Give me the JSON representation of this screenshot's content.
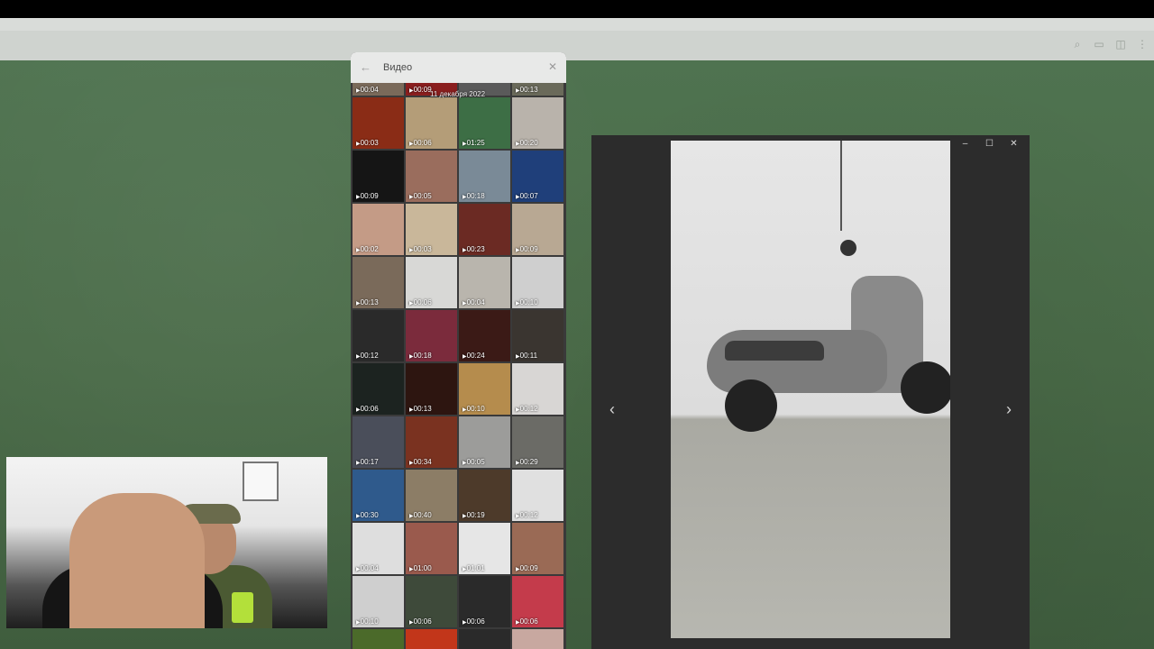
{
  "panel": {
    "title": "Видео",
    "date_label": "11 декабря 2022",
    "first_row_durations": [
      "00:04",
      "00:09",
      "",
      "00:13"
    ],
    "thumbnails": [
      {
        "duration": "00:03",
        "color": "#8a2c16"
      },
      {
        "duration": "00:06",
        "color": "#b49d78"
      },
      {
        "duration": "01:25",
        "color": "#3d6e45"
      },
      {
        "duration": "00:20",
        "color": "#b9b3ab"
      },
      {
        "duration": "00:09",
        "color": "#151515"
      },
      {
        "duration": "00:05",
        "color": "#9a6d5d"
      },
      {
        "duration": "00:18",
        "color": "#7a8a97"
      },
      {
        "duration": "00:07",
        "color": "#1f3f7a"
      },
      {
        "duration": "00:02",
        "color": "#c49b86"
      },
      {
        "duration": "00:03",
        "color": "#c9b79a"
      },
      {
        "duration": "00:23",
        "color": "#6b2a23"
      },
      {
        "duration": "00:09",
        "color": "#b8a893"
      },
      {
        "duration": "00:13",
        "color": "#7a6a5a"
      },
      {
        "duration": "00:06",
        "color": "#d8d8d6"
      },
      {
        "duration": "00:04",
        "color": "#b9b5ad"
      },
      {
        "duration": "00:10",
        "color": "#cfcfcf"
      },
      {
        "duration": "00:12",
        "color": "#2a2a2a"
      },
      {
        "duration": "00:18",
        "color": "#7b2b3c"
      },
      {
        "duration": "00:24",
        "color": "#3b1a16"
      },
      {
        "duration": "00:11",
        "color": "#3a3530"
      },
      {
        "duration": "00:06",
        "color": "#1c2320"
      },
      {
        "duration": "00:13",
        "color": "#2d1510"
      },
      {
        "duration": "00:10",
        "color": "#b58c4d"
      },
      {
        "duration": "00:12",
        "color": "#d8d6d4"
      },
      {
        "duration": "00:17",
        "color": "#4a4e5a"
      },
      {
        "duration": "00:34",
        "color": "#7a3220"
      },
      {
        "duration": "00:05",
        "color": "#9c9c9a"
      },
      {
        "duration": "00:29",
        "color": "#6b6b66"
      },
      {
        "duration": "00:30",
        "color": "#2f5a8c"
      },
      {
        "duration": "00:40",
        "color": "#8c7d66"
      },
      {
        "duration": "00:19",
        "color": "#4d3a2a"
      },
      {
        "duration": "00:12",
        "color": "#e0e0e0"
      },
      {
        "duration": "00:04",
        "color": "#dedede"
      },
      {
        "duration": "01:00",
        "color": "#9a5a4d"
      },
      {
        "duration": "01:01",
        "color": "#e6e6e6"
      },
      {
        "duration": "00:09",
        "color": "#9a6a55"
      },
      {
        "duration": "00:10",
        "color": "#cfcfcf"
      },
      {
        "duration": "00:06",
        "color": "#3e4a3a"
      },
      {
        "duration": "00:06",
        "color": "#2a2a2a"
      },
      {
        "duration": "00:06",
        "color": "#c43b4b"
      }
    ],
    "last_row_colors": [
      "#4b6a2a",
      "#c2361a",
      "#2a2a2a",
      "#c8a8a0"
    ]
  },
  "viewer": {
    "prev_arrow": "‹",
    "next_arrow": "›",
    "window_controls": {
      "minimize": "–",
      "maximize": "☐",
      "close": "✕"
    }
  },
  "header_icons": [
    "search-icon",
    "comments-icon",
    "sidebar-icon",
    "more-icon"
  ]
}
